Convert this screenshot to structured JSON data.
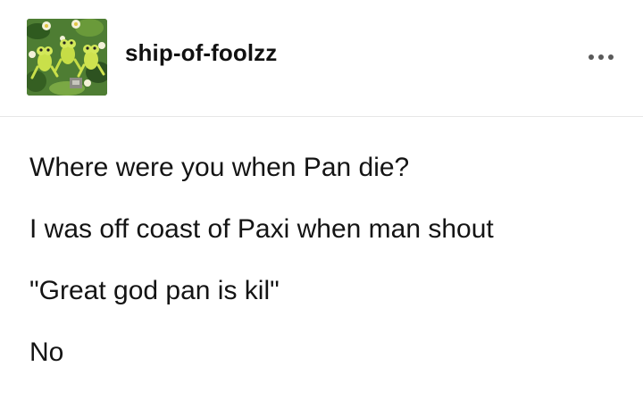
{
  "post": {
    "blog_name": "ship-of-foolzz",
    "avatar_icon": "frog-avatar-icon",
    "more_icon": "ellipsis-icon",
    "paragraphs": [
      "Where were you when Pan die?",
      "I was off coast of Paxi when man shout",
      "\"Great god pan is kil\"",
      "No"
    ]
  }
}
